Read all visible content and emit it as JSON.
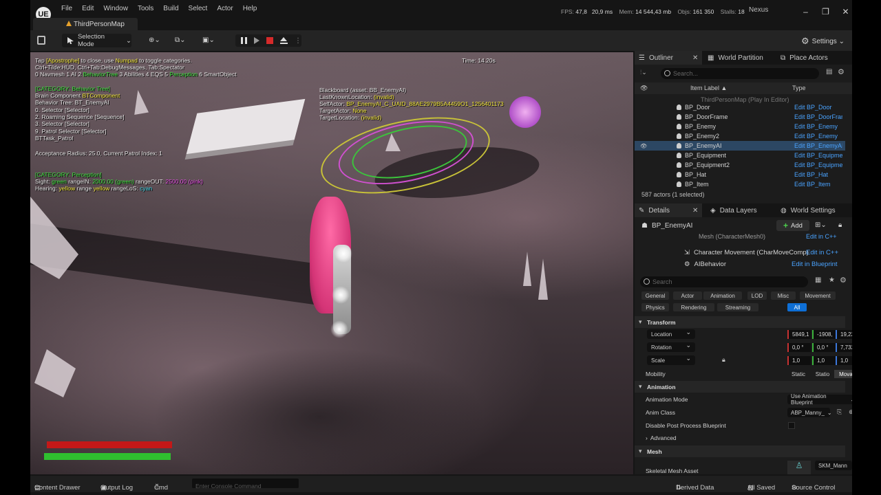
{
  "app": {
    "logo": "UE",
    "menu": [
      "File",
      "Edit",
      "Window",
      "Tools",
      "Build",
      "Select",
      "Actor",
      "Help"
    ],
    "stats": [
      {
        "label": "FPS:",
        "value": "47,8"
      },
      {
        "label": "",
        "value": "20,9 ms"
      },
      {
        "label": "Mem:",
        "value": "14 544,43 mb"
      },
      {
        "label": "Objs:",
        "value": "161 350"
      },
      {
        "label": "Stalls:",
        "value": "18"
      }
    ],
    "project": "Nexus",
    "map_tab": "ThirdPersonMap"
  },
  "toolbar": {
    "selection_mode": "Selection Mode",
    "settings": "Settings"
  },
  "viewport": {
    "time": "Time: 14.20s",
    "debug_lines": [
      {
        "parts": [
          {
            "t": "Tap "
          },
          {
            "t": "[Apostrophe]",
            "c": "y"
          },
          {
            "t": " to close, use "
          },
          {
            "t": "Numpad",
            "c": "y"
          },
          {
            "t": " to toggle categories."
          }
        ]
      },
      {
        "parts": [
          {
            "t": "Ctrl+Tilde:HUD, Ctrl+Tab:DebugMessages, Tab:Spectator"
          }
        ]
      },
      {
        "parts": [
          {
            "t": "0 Navmesh 1 AI 2 "
          },
          {
            "t": "BehaviorTree",
            "c": "g"
          },
          {
            "t": " 3 Abilities 4 EQS 5 "
          },
          {
            "t": "Perception",
            "c": "g"
          },
          {
            "t": " 6 SmartObject"
          }
        ]
      },
      {
        "parts": [
          {
            "t": "[CATEGORY: Behavior Tree]",
            "c": "g"
          }
        ]
      },
      {
        "parts": [
          {
            "t": "Brain Component "
          },
          {
            "t": "BTComponent",
            "c": "y"
          }
        ]
      },
      {
        "parts": [
          {
            "t": "Behavior Tree: BT_EnemyAI"
          }
        ]
      },
      {
        "parts": [
          {
            "t": "  0. Selector [Selector]"
          }
        ]
      },
      {
        "parts": [
          {
            "t": "  2. Roaming Sequence [Sequence]"
          }
        ]
      },
      {
        "parts": [
          {
            "t": "  3. Selector [Selector]"
          }
        ]
      },
      {
        "parts": [
          {
            "t": "  9. Patrol Selector [Selector]"
          }
        ]
      },
      {
        "parts": [
          {
            "t": "  BTTask_Patrol"
          }
        ]
      },
      {
        "parts": [
          {
            "t": "Acceptance Radius: 25.0, Current Patrol Index: 1"
          }
        ]
      },
      {
        "parts": [
          {
            "t": "[CATEGORY: Perception]",
            "c": "g"
          }
        ]
      },
      {
        "parts": [
          {
            "t": "Sight: "
          },
          {
            "t": "green",
            "c": "g"
          },
          {
            "t": " rangeIN: "
          },
          {
            "t": "2000.00 (green)",
            "c": "g"
          },
          {
            "t": " rangeOUT: "
          },
          {
            "t": "2500.00 (pink)",
            "c": "m"
          }
        ]
      },
      {
        "parts": [
          {
            "t": "Hearing: "
          },
          {
            "t": "yellow",
            "c": "y"
          },
          {
            "t": " range "
          },
          {
            "t": "yellow",
            "c": "y"
          },
          {
            "t": " rangeLoS: "
          },
          {
            "t": "cyan",
            "c": "c"
          }
        ]
      }
    ],
    "blackboard": [
      {
        "parts": [
          {
            "t": "Blackboard (asset: BB_EnemyAI)"
          }
        ]
      },
      {
        "parts": [
          {
            "t": "  LastKnownLocation: "
          },
          {
            "t": "(invalid)",
            "c": "y"
          }
        ]
      },
      {
        "parts": [
          {
            "t": "  SelfActor: "
          },
          {
            "t": "BP_EnemyAI_C_UAID_88AE2979B5A4459O1_1256401173",
            "c": "y"
          }
        ]
      },
      {
        "parts": [
          {
            "t": "  TargetActor: "
          },
          {
            "t": "None",
            "c": "y"
          }
        ]
      },
      {
        "parts": [
          {
            "t": "  TargetLocation: "
          },
          {
            "t": "(invalid)",
            "c": "y"
          }
        ]
      }
    ]
  },
  "outliner": {
    "tabs": [
      "Outliner",
      "World Partition",
      "Place Actors"
    ],
    "search_placeholder": "Search...",
    "col_label": "Item Label ▲",
    "col_type": "Type",
    "root": "ThirdPersonMap (Play In Editor)",
    "rows": [
      {
        "name": "BP_Door",
        "type": "Edit BP_Door"
      },
      {
        "name": "BP_DoorFrame",
        "type": "Edit BP_DoorFrame"
      },
      {
        "name": "BP_Enemy",
        "type": "Edit BP_Enemy"
      },
      {
        "name": "BP_Enemy2",
        "type": "Edit BP_Enemy"
      },
      {
        "name": "BP_EnemyAI",
        "type": "Edit BP_EnemyAI",
        "selected": true
      },
      {
        "name": "BP_Equipment",
        "type": "Edit BP_Equipment"
      },
      {
        "name": "BP_Equipment2",
        "type": "Edit BP_Equipment"
      },
      {
        "name": "BP_Hat",
        "type": "Edit BP_Hat"
      },
      {
        "name": "BP_Item",
        "type": "Edit BP_Item"
      }
    ],
    "count": "587 actors (1 selected)"
  },
  "details": {
    "tabs": [
      "Details",
      "Data Layers",
      "World Settings"
    ],
    "actor": "BP_EnemyAI",
    "add": "Add",
    "components": [
      {
        "name": "Mesh (CharacterMesh0)",
        "action": "Edit in C++"
      },
      {
        "name": "Character Movement (CharMoveComp)",
        "action": "Edit in C++"
      },
      {
        "name": "AIBehavior",
        "action": "Edit in Blueprint"
      }
    ],
    "search_placeholder": "Search",
    "categories_row1": [
      "General",
      "Actor",
      "Animation",
      "LOD",
      "Misc",
      "Movement"
    ],
    "categories_row2": [
      "Physics",
      "Rendering",
      "Streaming",
      "All"
    ],
    "transform": {
      "title": "Transform",
      "location": {
        "label": "Location",
        "x": "5849,1",
        "y": "-1908,",
        "z": "19,224"
      },
      "rotation": {
        "label": "Rotation",
        "x": "0,0 °",
        "y": "0,0 °",
        "z": "7,7322"
      },
      "scale": {
        "label": "Scale",
        "x": "1,0",
        "y": "1,0",
        "z": "1,0"
      },
      "mobility_label": "Mobility",
      "mobility": [
        "Static",
        "Statio",
        "Movat"
      ]
    },
    "animation": {
      "title": "Animation",
      "mode_label": "Animation Mode",
      "mode_value": "Use Animation Blueprint",
      "class_label": "Anim Class",
      "class_value": "ABP_Manny_",
      "disable_pp": "Disable Post Process Blueprint",
      "advanced": "Advanced"
    },
    "mesh": {
      "title": "Mesh",
      "asset_label": "Skeletal Mesh Asset",
      "asset_value": "SKM_Mann"
    }
  },
  "statusbar": {
    "content_drawer": "Content Drawer",
    "output_log": "Output Log",
    "cmd": "Cmd",
    "console_placeholder": "Enter Console Command",
    "derived_data": "Derived Data",
    "all_saved": "All Saved",
    "source_control": "Source Control"
  },
  "colors": {
    "selected_row": "#2c4763",
    "link": "#4aa3ff",
    "health": "#c41818",
    "stamina": "#2fbf2f",
    "stop": "#d62a2a"
  }
}
